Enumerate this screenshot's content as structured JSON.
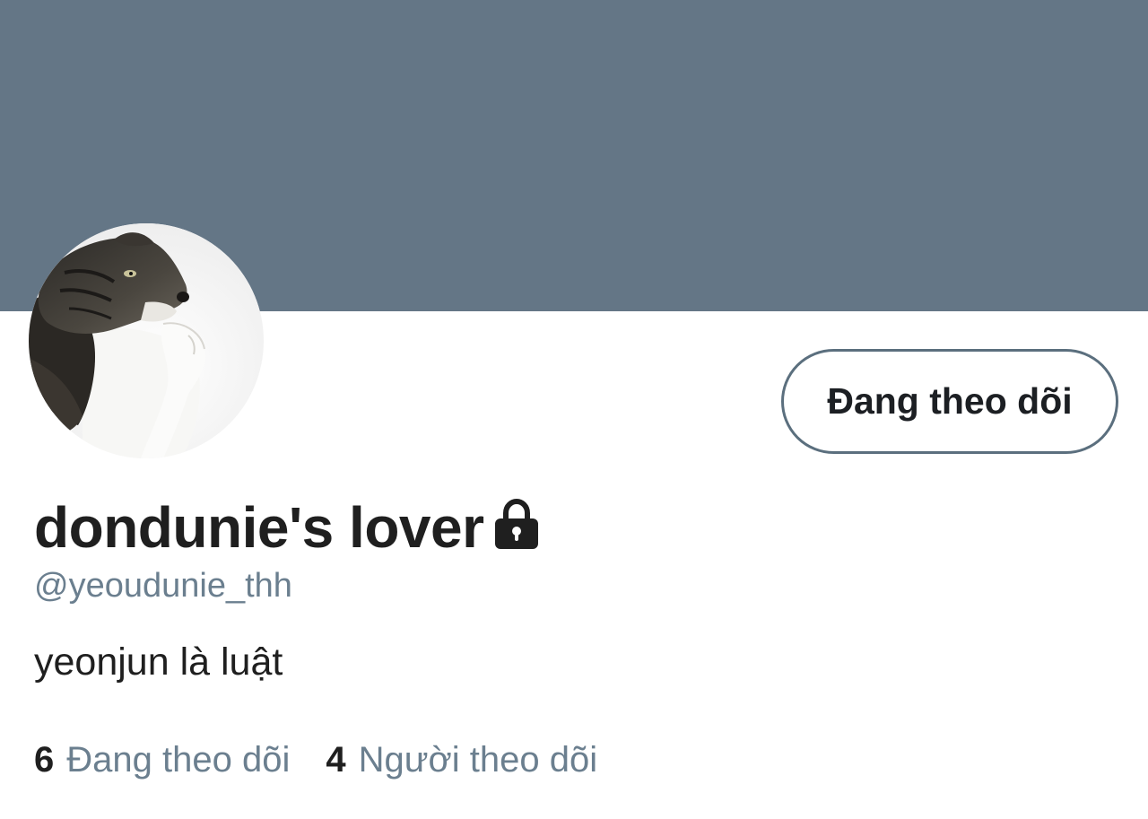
{
  "profile": {
    "banner_color": "#647686",
    "avatar_icon": "cat-photo",
    "display_name": "dondunie's lover",
    "protected_icon": "lock-icon",
    "handle": "@yeoudunie_thh",
    "bio": "yeonjun là luật"
  },
  "actions": {
    "follow_button_label": "Đang theo dõi"
  },
  "stats": {
    "following_count": "6",
    "following_label": "Đang theo dõi",
    "followers_count": "4",
    "followers_label": "Người theo dõi"
  },
  "colors": {
    "text_primary": "#1f1f1f",
    "text_secondary": "#6b7f8f",
    "button_border": "#5b6f7e"
  }
}
